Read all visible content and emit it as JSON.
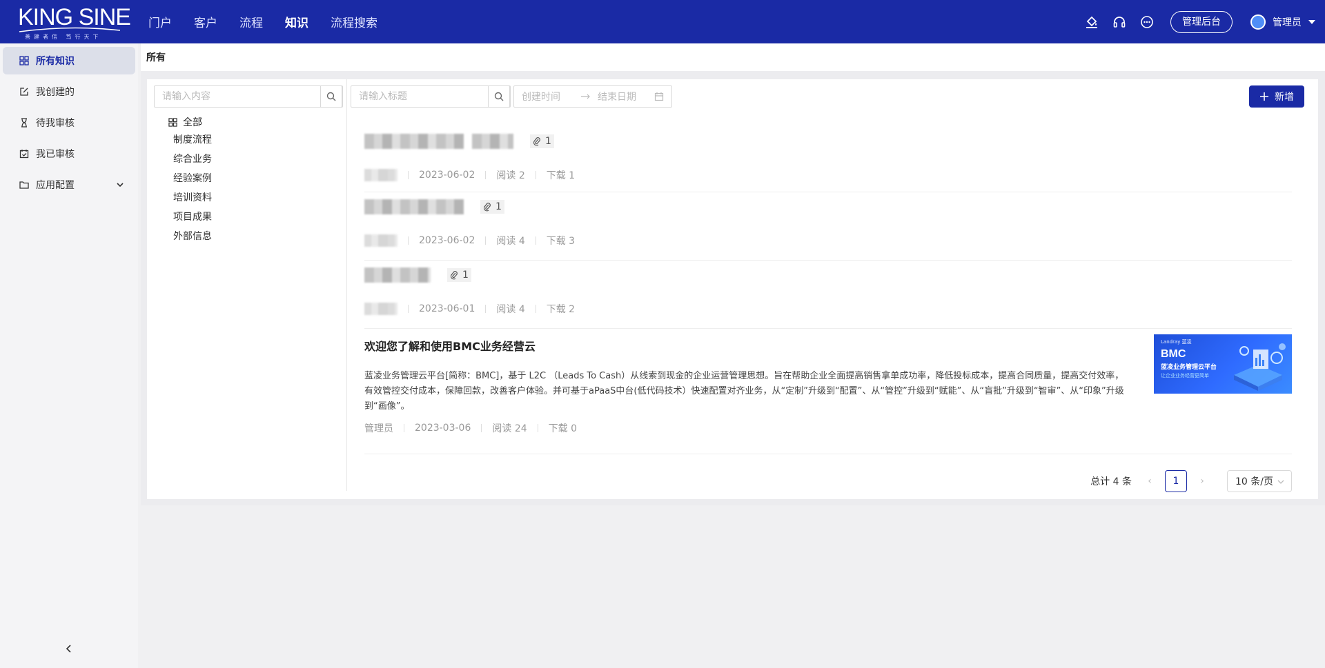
{
  "brand": {
    "name": "KING SINE",
    "slogan": "善建者信 笃行天下"
  },
  "nav": {
    "items": [
      "门户",
      "客户",
      "流程",
      "知识",
      "流程搜索"
    ],
    "active": "知识"
  },
  "header": {
    "admin_button": "管理后台",
    "user_name": "管理员"
  },
  "sidebar": {
    "items": [
      {
        "label": "所有知识",
        "icon": "grid-icon",
        "active": true
      },
      {
        "label": "我创建的",
        "icon": "edit-doc-icon"
      },
      {
        "label": "待我审核",
        "icon": "hourglass-icon"
      },
      {
        "label": "我已审核",
        "icon": "calendar-check-icon"
      },
      {
        "label": "应用配置",
        "icon": "folder-icon"
      }
    ]
  },
  "breadcrumb": "所有",
  "filters": {
    "content_placeholder": "请输入内容",
    "title_placeholder": "请输入标题",
    "start_placeholder": "创建时间",
    "end_placeholder": "结束日期",
    "add_label": "新增"
  },
  "tree": {
    "root": "全部",
    "items": [
      "制度流程",
      "综合业务",
      "经验案例",
      "培训资料",
      "项目成果",
      "外部信息"
    ]
  },
  "articles": [
    {
      "attachments": "1",
      "date": "2023-06-02",
      "reads": "阅读 2",
      "downloads": "下载 1"
    },
    {
      "attachments": "1",
      "date": "2023-06-02",
      "reads": "阅读 4",
      "downloads": "下载 3"
    },
    {
      "attachments": "1",
      "date": "2023-06-01",
      "reads": "阅读 4",
      "downloads": "下载 2"
    },
    {
      "title": "欢迎您了解和使用BMC业务经营云",
      "description": "蓝凌业务管理云平台[简称：BMC]，基于 L2C （Leads To Cash）从线索到现金的企业运营管理思想。旨在帮助企业全面提高销售拿单成功率，降低投标成本，提高合同质量，提高交付效率，有效管控交付成本，保障回款，改善客户体验。并可基于aPaaS中台(低代码技术）快速配置对齐业务，从“定制”升级到“配置”、从“管控”升级到“赋能”、从“盲批”升级到“智审”、从“印象”升级到“画像”。",
      "author": "管理员",
      "date": "2023-03-06",
      "reads": "阅读 24",
      "downloads": "下载 0",
      "thumbnail": {
        "brand": "Landray 蓝凌",
        "title": "BMC",
        "subtitle": "蓝凌业务管理云平台",
        "tagline": "让企业业务经营更简单"
      }
    }
  ],
  "pagination": {
    "total": "总计 4 条",
    "current": "1",
    "page_size": "10 条/页"
  },
  "colors": {
    "primary": "#1a2aa5"
  }
}
